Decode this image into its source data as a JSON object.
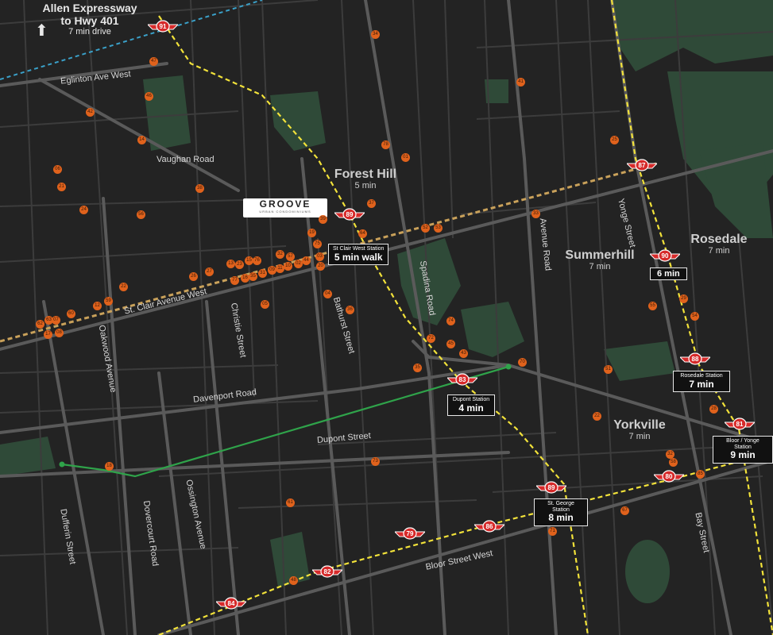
{
  "colors": {
    "background": "#232323",
    "street": "#5a5a5a",
    "minor_street": "#3c3c3c",
    "park": "#2f4a38",
    "subway": "#f2e23a",
    "crosstown": "#c9a15a",
    "walk_route": "#2fa34a",
    "expressway": "#3aa0c8",
    "poi": "#e0621c",
    "ttc_red": "#d62a2a"
  },
  "callout": {
    "title": "Allen Expressway",
    "subtitle": "to Hwy 401",
    "drive": "7 min drive",
    "icon": "arrow-up-icon"
  },
  "logo": {
    "name": "GROOVE",
    "tagline": "URBAN CONDOMINIUMS"
  },
  "areas": [
    {
      "name": "Forest Hill",
      "time": "5 min"
    },
    {
      "name": "Summerhill",
      "time": "7 min"
    },
    {
      "name": "Rosedale",
      "time": "7 min"
    },
    {
      "name": "Yorkville",
      "time": "7 min"
    }
  ],
  "stations": [
    {
      "name": "St Clair West Station",
      "time": "5 min walk"
    },
    {
      "name": "",
      "time": "6 min"
    },
    {
      "name": "Rosedale Station",
      "time": "7 min"
    },
    {
      "name": "Dupont Station",
      "time": "4 min"
    },
    {
      "name": "St. George Station",
      "time": "8 min"
    },
    {
      "name": "Bloor / Yonge Station",
      "time": "9 min"
    }
  ],
  "streets": [
    "Eglinton Ave West",
    "Vaughan Road",
    "St. Clair Avenue West",
    "Christie Street",
    "Bathurst Street",
    "Spadina Road",
    "Avenue Road",
    "Yonge Street",
    "Davenport Road",
    "Dupont Street",
    "Oakwood Avenue",
    "Dufferin Street",
    "Dovercourt Road",
    "Ossington Avenue",
    "Bloor Street West",
    "Bay Street"
  ],
  "ttc_numbers": [
    "91",
    "89",
    "87",
    "90",
    "88",
    "83",
    "81",
    "80",
    "89",
    "86",
    "79",
    "82",
    "84"
  ],
  "poi_numbers": [
    "47",
    "46",
    "42",
    "14",
    "34",
    "41",
    "78",
    "01",
    "25",
    "06",
    "21",
    "38",
    "24",
    "56",
    "37",
    "39",
    "33",
    "19",
    "52",
    "53",
    "64",
    "75",
    "03",
    "04",
    "36",
    "26",
    "27",
    "13",
    "23",
    "15",
    "76",
    "77",
    "16",
    "35",
    "31",
    "09",
    "11",
    "10",
    "02",
    "20",
    "44",
    "57",
    "32",
    "05",
    "07",
    "60",
    "12",
    "59",
    "22",
    "62",
    "63",
    "17",
    "08",
    "29",
    "55",
    "54",
    "74",
    "72",
    "45",
    "43",
    "35",
    "70",
    "51",
    "22",
    "32",
    "58",
    "28",
    "85",
    "61",
    "73",
    "18",
    "67",
    "48",
    "71"
  ]
}
